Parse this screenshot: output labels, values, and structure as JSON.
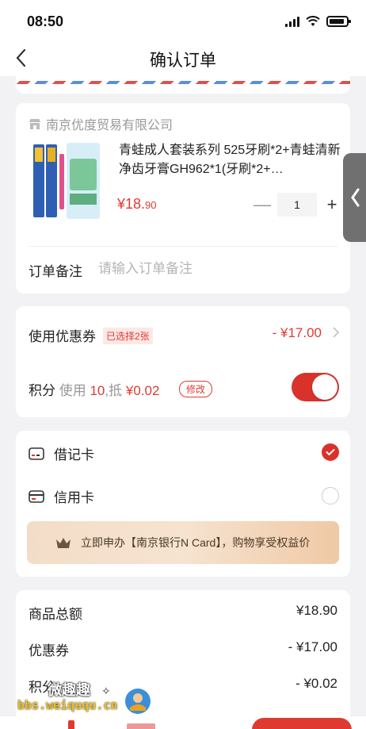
{
  "status_bar": {
    "time": "08:50"
  },
  "nav": {
    "title": "确认订单"
  },
  "shop": {
    "name": "南京优度贸易有限公司",
    "product_title": "青蛙成人套装系列 525牙刷*2+青蛙清新净齿牙膏GH962*1(牙刷*2+…",
    "price_main": "¥18.",
    "price_decimal": "90",
    "quantity": "1",
    "qty_minus": "—",
    "qty_plus": "+",
    "remark_label": "订单备注",
    "remark_placeholder": "请输入订单备注"
  },
  "side_tab": {
    "icon": "chevron-left-icon"
  },
  "discounts": {
    "coupon_label": "使用优惠券",
    "coupon_badge": "已选择2张",
    "coupon_value": "- ¥17.00",
    "points_label": "积分",
    "points_use": "使用",
    "points_count": "10",
    "points_deduct_prefix": ",抵",
    "points_deduct_value": "¥0.02",
    "modify_label": "修改",
    "points_enabled": true
  },
  "payment": {
    "debit_label": "借记卡",
    "credit_label": "信用卡",
    "selected": "debit",
    "promo_text": "立即申办【南京银行N Card】，购物享受权益价"
  },
  "summary": {
    "rows": [
      {
        "label": "商品总额",
        "value": "¥18.90"
      },
      {
        "label": "优惠券",
        "value": "- ¥17.00"
      },
      {
        "label": "积分",
        "value": "- ¥0.02"
      }
    ]
  },
  "watermark": {
    "text_cn": "微趣趣",
    "url": "bbs.weiququ.cn"
  },
  "colors": {
    "accent": "#e03a30",
    "toggle": "#d9322b",
    "background": "#f2f2f4"
  }
}
